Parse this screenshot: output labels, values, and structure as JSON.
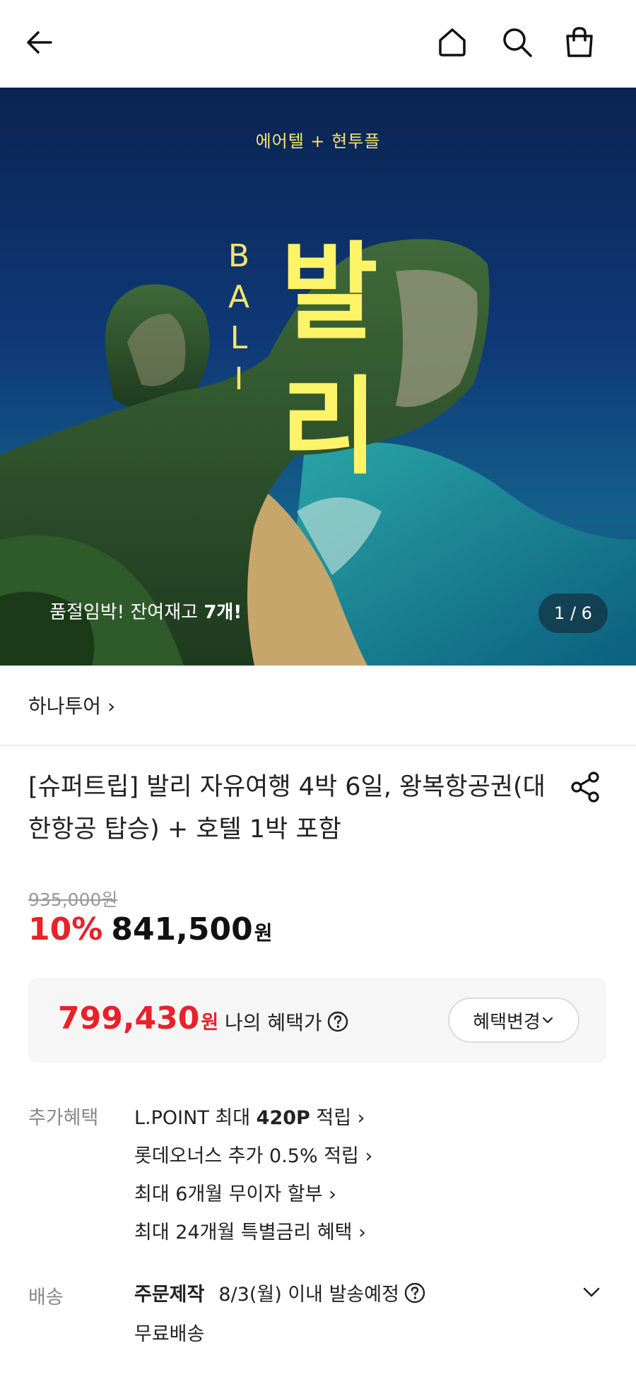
{
  "hero": {
    "subtitle": "에어텔 + 현투플",
    "latin_letters": [
      "B",
      "A",
      "L",
      "I"
    ],
    "title_chars": [
      "발",
      "리"
    ],
    "stock_text": "품절임박! 잔여재고 ",
    "stock_count": "7개!",
    "counter": "1 / 6"
  },
  "brand": {
    "name": "하나투어 ›"
  },
  "product": {
    "title": "[슈퍼트립] 발리 자유여행 4박 6일, 왕복항공권(대한항공 탑승) + 호텔 1박 포함",
    "original_price": "935,000원",
    "discount_pct": "10%",
    "price": "841,500",
    "price_unit": "원"
  },
  "benefit": {
    "price": "799,430",
    "unit": "원",
    "label": "나의 혜택가",
    "change_button": "혜택변경"
  },
  "extra": {
    "label": "추가혜택",
    "item0_prefix": "L.POINT 최대 ",
    "item0_bold": "420P",
    "item0_suffix": " 적립 ›",
    "item1": "롯데오너스 추가 0.5% 적립 ›",
    "item2": "최대 6개월 무이자 할부 ›",
    "item3": "최대 24개월 특별금리 혜택 ›"
  },
  "shipping": {
    "label": "배송",
    "type": "주문제작",
    "date": "8/3(월) 이내 발송예정",
    "fee": "무료배송"
  },
  "colors": {
    "accent": "#e8212a",
    "hero_yellow": "#fff368"
  },
  "icons": [
    "back-arrow-icon",
    "home-icon",
    "search-icon",
    "shopping-bag-icon",
    "share-icon",
    "help-circle-icon",
    "chevron-down-icon"
  ]
}
